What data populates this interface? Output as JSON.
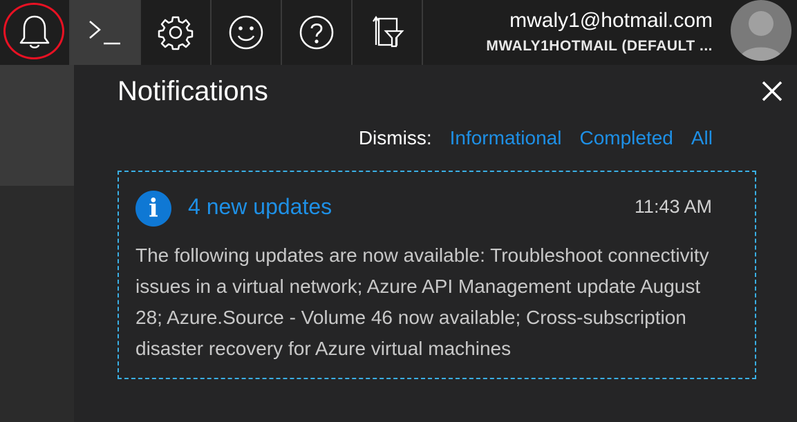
{
  "topbar": {
    "buttons": [
      {
        "icon": "bell-icon",
        "active": false
      },
      {
        "icon": "cloud-shell-icon",
        "active": true
      },
      {
        "icon": "gear-icon",
        "active": false
      },
      {
        "icon": "smiley-icon",
        "active": false
      },
      {
        "icon": "help-icon",
        "active": false
      },
      {
        "icon": "directory-filter-icon",
        "active": false
      }
    ],
    "highlight_color": "#e81123",
    "account": {
      "email": "mwaly1@hotmail.com",
      "directory": "MWALY1HOTMAIL (DEFAULT ..."
    },
    "avatar_icon": "user-avatar-icon"
  },
  "panel": {
    "title": "Notifications",
    "close_icon": "close-icon",
    "dismiss": {
      "label": "Dismiss:",
      "links": [
        "Informational",
        "Completed",
        "All"
      ]
    },
    "notification": {
      "icon": "info-icon",
      "title": "4 new updates",
      "time": "11:43 AM",
      "body": "The following updates are now available: Troubleshoot connectivity issues in a virtual network; Azure API Management update August 28; Azure.Source - Volume 46 now available; Cross-subscription disaster recovery for Azure virtual machines"
    }
  },
  "colors": {
    "topbar_bg": "#1e1e1e",
    "panel_bg": "#252526",
    "link": "#1e90e6",
    "info_blue": "#0f78d4",
    "card_border": "#3ab0e6"
  }
}
